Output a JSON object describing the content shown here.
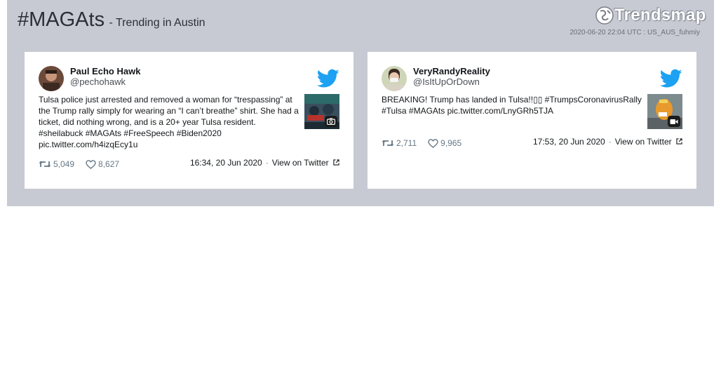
{
  "header": {
    "hashtag": "#MAGAts",
    "subtitle": "- Trending in Austin",
    "brand": "Trendsmap",
    "timestamp": "2020-06-20 22:04 UTC : US_AUS_fuhmiy"
  },
  "tweets": [
    {
      "name": "Paul Echo Hawk",
      "handle": "@pechohawk",
      "text": "Tulsa police just arrested and removed a woman for “trespassing” at the Trump rally simply for wearing an “I can’t breathe” shirt. She had a ticket, did nothing wrong, and is a 20+ year Tulsa resident. #sheilabuck #MAGAts #FreeSpeech #Biden2020 pic.twitter.com/h4izqEcy1u",
      "retweets": "5,049",
      "likes": "8,627",
      "time": "16:34, 20 Jun 2020",
      "view_label": "View on Twitter",
      "media_icon": "camera-icon"
    },
    {
      "name": "VeryRandyReality",
      "handle": "@IsItUpOrDown",
      "text": "BREAKING! Trump has landed in Tulsa!!▯▯ #TrumpsCoronavirusRally #Tulsa #MAGAts pic.twitter.com/LnyGRh5TJA",
      "retweets": "2,711",
      "likes": "9,965",
      "time": "17:53, 20 Jun 2020",
      "view_label": "View on Twitter",
      "media_icon": "video-icon"
    }
  ],
  "colors": {
    "banner": "#c7cad3",
    "twitter_blue": "#1da1f2",
    "stat_gray": "#657786"
  }
}
